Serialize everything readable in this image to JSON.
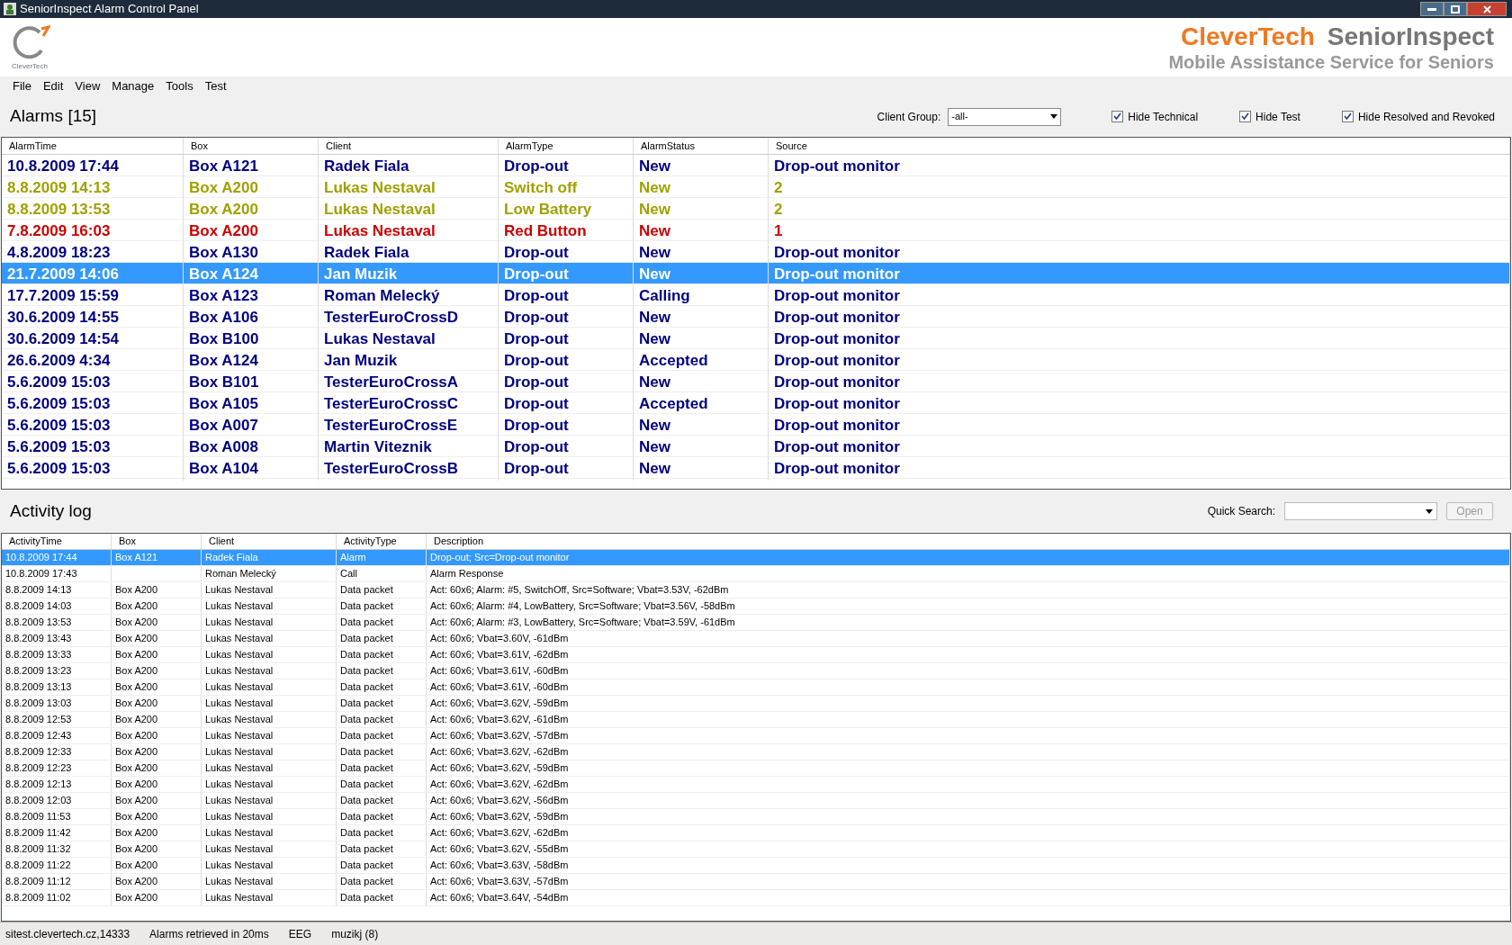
{
  "window": {
    "title": "SeniorInspect Alarm Control Panel"
  },
  "brand": {
    "logo_caption": "CleverTech",
    "name_primary": "CleverTech",
    "name_secondary": "SeniorInspect",
    "tagline": "Mobile Assistance Service for Seniors"
  },
  "menu": [
    "File",
    "Edit",
    "View",
    "Manage",
    "Tools",
    "Test"
  ],
  "alarms": {
    "title": "Alarms [15]",
    "client_group": {
      "label": "Client Group:",
      "value": "-all-"
    },
    "filters": [
      {
        "label": "Hide Technical",
        "checked": true
      },
      {
        "label": "Hide Test",
        "checked": true
      },
      {
        "label": "Hide Resolved and Revoked",
        "checked": true
      }
    ],
    "columns": [
      "AlarmTime",
      "Box",
      "Client",
      "AlarmType",
      "AlarmStatus",
      "Source"
    ],
    "rows": [
      {
        "cells": [
          "10.8.2009 17:44",
          "Box A121",
          "Radek Fiala",
          "Drop-out",
          "New",
          "Drop-out monitor"
        ],
        "color": "#000080",
        "selected": false
      },
      {
        "cells": [
          "8.8.2009 14:13",
          "Box A200",
          "Lukas Nestaval",
          "Switch off",
          "New",
          "2"
        ],
        "color": "#a0a000",
        "selected": false
      },
      {
        "cells": [
          "8.8.2009 13:53",
          "Box A200",
          "Lukas Nestaval",
          "Low Battery",
          "New",
          "2"
        ],
        "color": "#a0a000",
        "selected": false
      },
      {
        "cells": [
          "7.8.2009 16:03",
          "Box A200",
          "Lukas Nestaval",
          "Red Button",
          "New",
          "1"
        ],
        "color": "#cc0000",
        "selected": false
      },
      {
        "cells": [
          "4.8.2009 18:23",
          "Box A130",
          "Radek Fiala",
          "Drop-out",
          "New",
          "Drop-out monitor"
        ],
        "color": "#000080",
        "selected": false
      },
      {
        "cells": [
          "21.7.2009 14:06",
          "Box A124",
          "Jan Muzik",
          "Drop-out",
          "New",
          "Drop-out monitor"
        ],
        "selected": true
      },
      {
        "cells": [
          "17.7.2009 15:59",
          "Box A123",
          "Roman Melecký",
          "Drop-out",
          "Calling",
          "Drop-out monitor"
        ],
        "color": "#000080",
        "selected": false
      },
      {
        "cells": [
          "30.6.2009 14:55",
          "Box A106",
          "TesterEuroCrossD",
          "Drop-out",
          "New",
          "Drop-out monitor"
        ],
        "color": "#000080",
        "selected": false
      },
      {
        "cells": [
          "30.6.2009 14:54",
          "Box B100",
          "Lukas Nestaval",
          "Drop-out",
          "New",
          "Drop-out monitor"
        ],
        "color": "#000080",
        "selected": false
      },
      {
        "cells": [
          "26.6.2009 4:34",
          "Box A124",
          "Jan Muzik",
          "Drop-out",
          "Accepted",
          "Drop-out monitor"
        ],
        "color": "#000080",
        "selected": false
      },
      {
        "cells": [
          "5.6.2009 15:03",
          "Box B101",
          "TesterEuroCrossA",
          "Drop-out",
          "New",
          "Drop-out monitor"
        ],
        "color": "#000080",
        "selected": false
      },
      {
        "cells": [
          "5.6.2009 15:03",
          "Box A105",
          "TesterEuroCrossC",
          "Drop-out",
          "Accepted",
          "Drop-out monitor"
        ],
        "color": "#000080",
        "selected": false
      },
      {
        "cells": [
          "5.6.2009 15:03",
          "Box A007",
          "TesterEuroCrossE",
          "Drop-out",
          "New",
          "Drop-out monitor"
        ],
        "color": "#000080",
        "selected": false
      },
      {
        "cells": [
          "5.6.2009 15:03",
          "Box A008",
          "Martin Viteznik",
          "Drop-out",
          "New",
          "Drop-out monitor"
        ],
        "color": "#000080",
        "selected": false
      },
      {
        "cells": [
          "5.6.2009 15:03",
          "Box A104",
          "TesterEuroCrossB",
          "Drop-out",
          "New",
          "Drop-out monitor"
        ],
        "color": "#000080",
        "selected": false
      }
    ]
  },
  "activity": {
    "title": "Activity log",
    "quick_search": {
      "label": "Quick Search:"
    },
    "open_button": {
      "label": "Open",
      "disabled": true
    },
    "columns": [
      "ActivityTime",
      "Box",
      "Client",
      "ActivityType",
      "Description"
    ],
    "rows": [
      {
        "cells": [
          "10.8.2009 17:44",
          "Box A121",
          "Radek Fiala",
          "Alarm",
          "Drop-out; Src=Drop-out monitor"
        ],
        "selected": true
      },
      {
        "cells": [
          "10.8.2009 17:43",
          "",
          "Roman Melecký",
          "Call",
          "Alarm Response"
        ],
        "selected": false
      },
      {
        "cells": [
          "8.8.2009 14:13",
          "Box A200",
          "Lukas Nestaval",
          "Data packet",
          "Act: 60x6; Alarm: #5, SwitchOff, Src=Software; Vbat=3.53V, -62dBm"
        ],
        "selected": false
      },
      {
        "cells": [
          "8.8.2009 14:03",
          "Box A200",
          "Lukas Nestaval",
          "Data packet",
          "Act: 60x6; Alarm: #4, LowBattery, Src=Software; Vbat=3.56V, -58dBm"
        ],
        "selected": false
      },
      {
        "cells": [
          "8.8.2009 13:53",
          "Box A200",
          "Lukas Nestaval",
          "Data packet",
          "Act: 60x6; Alarm: #3, LowBattery, Src=Software; Vbat=3.59V, -61dBm"
        ],
        "selected": false
      },
      {
        "cells": [
          "8.8.2009 13:43",
          "Box A200",
          "Lukas Nestaval",
          "Data packet",
          "Act: 60x6; Vbat=3.60V, -61dBm"
        ],
        "selected": false
      },
      {
        "cells": [
          "8.8.2009 13:33",
          "Box A200",
          "Lukas Nestaval",
          "Data packet",
          "Act: 60x6; Vbat=3.61V, -62dBm"
        ],
        "selected": false
      },
      {
        "cells": [
          "8.8.2009 13:23",
          "Box A200",
          "Lukas Nestaval",
          "Data packet",
          "Act: 60x6; Vbat=3.61V, -60dBm"
        ],
        "selected": false
      },
      {
        "cells": [
          "8.8.2009 13:13",
          "Box A200",
          "Lukas Nestaval",
          "Data packet",
          "Act: 60x6; Vbat=3.61V, -60dBm"
        ],
        "selected": false
      },
      {
        "cells": [
          "8.8.2009 13:03",
          "Box A200",
          "Lukas Nestaval",
          "Data packet",
          "Act: 60x6; Vbat=3.62V, -59dBm"
        ],
        "selected": false
      },
      {
        "cells": [
          "8.8.2009 12:53",
          "Box A200",
          "Lukas Nestaval",
          "Data packet",
          "Act: 60x6; Vbat=3.62V, -61dBm"
        ],
        "selected": false
      },
      {
        "cells": [
          "8.8.2009 12:43",
          "Box A200",
          "Lukas Nestaval",
          "Data packet",
          "Act: 60x6; Vbat=3.62V, -57dBm"
        ],
        "selected": false
      },
      {
        "cells": [
          "8.8.2009 12:33",
          "Box A200",
          "Lukas Nestaval",
          "Data packet",
          "Act: 60x6; Vbat=3.62V, -62dBm"
        ],
        "selected": false
      },
      {
        "cells": [
          "8.8.2009 12:23",
          "Box A200",
          "Lukas Nestaval",
          "Data packet",
          "Act: 60x6; Vbat=3.62V, -59dBm"
        ],
        "selected": false
      },
      {
        "cells": [
          "8.8.2009 12:13",
          "Box A200",
          "Lukas Nestaval",
          "Data packet",
          "Act: 60x6; Vbat=3.62V, -62dBm"
        ],
        "selected": false
      },
      {
        "cells": [
          "8.8.2009 12:03",
          "Box A200",
          "Lukas Nestaval",
          "Data packet",
          "Act: 60x6; Vbat=3.62V, -56dBm"
        ],
        "selected": false
      },
      {
        "cells": [
          "8.8.2009 11:53",
          "Box A200",
          "Lukas Nestaval",
          "Data packet",
          "Act: 60x6; Vbat=3.62V, -59dBm"
        ],
        "selected": false
      },
      {
        "cells": [
          "8.8.2009 11:42",
          "Box A200",
          "Lukas Nestaval",
          "Data packet",
          "Act: 60x6; Vbat=3.62V, -62dBm"
        ],
        "selected": false
      },
      {
        "cells": [
          "8.8.2009 11:32",
          "Box A200",
          "Lukas Nestaval",
          "Data packet",
          "Act: 60x6; Vbat=3.62V, -55dBm"
        ],
        "selected": false
      },
      {
        "cells": [
          "8.8.2009 11:22",
          "Box A200",
          "Lukas Nestaval",
          "Data packet",
          "Act: 60x6; Vbat=3.63V, -58dBm"
        ],
        "selected": false
      },
      {
        "cells": [
          "8.8.2009 11:12",
          "Box A200",
          "Lukas Nestaval",
          "Data packet",
          "Act: 60x6; Vbat=3.63V, -57dBm"
        ],
        "selected": false
      },
      {
        "cells": [
          "8.8.2009 11:02",
          "Box A200",
          "Lukas Nestaval",
          "Data packet",
          "Act: 60x6; Vbat=3.64V, -54dBm"
        ],
        "selected": false
      }
    ]
  },
  "status_bar": [
    "sitest.clevertech.cz,14333",
    "Alarms retrieved in 20ms",
    "EEG",
    "muzikj (8)"
  ]
}
